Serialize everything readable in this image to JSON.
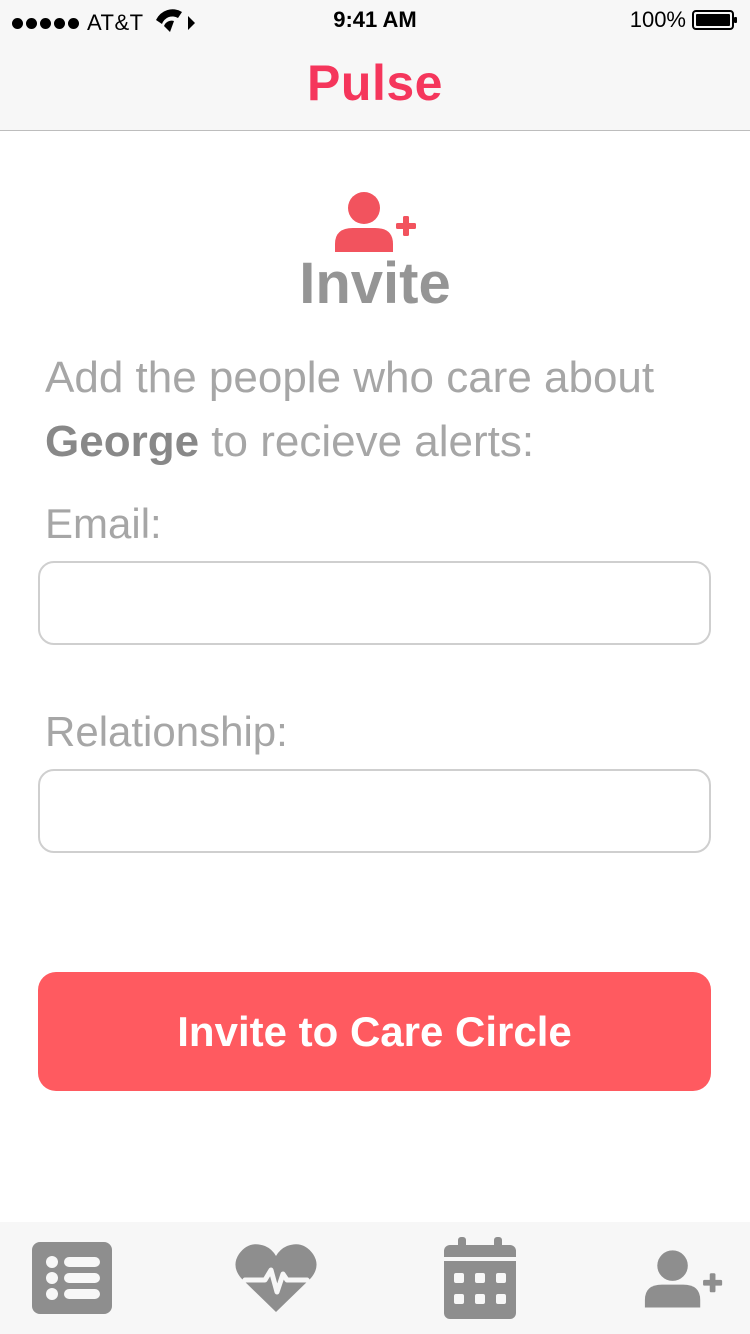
{
  "status_bar": {
    "carrier": "AT&T",
    "time": "9:41 AM",
    "battery_percent": "100%",
    "battery_level": 1.0,
    "signal_bars": 5
  },
  "app": {
    "title": "Pulse",
    "brand_color": "#f5365c",
    "accent_color": "#ff5a60"
  },
  "header": {
    "icon": "user-plus-icon",
    "heading": "Invite"
  },
  "description": {
    "before": "Add the people who care about",
    "patient_name": "George",
    "after": "to recieve alerts:"
  },
  "form": {
    "email_label": "Email:",
    "email_value": "",
    "relationship_label": "Relationship:",
    "relationship_value": ""
  },
  "cta": {
    "label": "Invite to Care Circle"
  },
  "tab_bar": {
    "tabs": [
      {
        "icon": "list-icon"
      },
      {
        "icon": "heart-pulse-icon"
      },
      {
        "icon": "calendar-icon"
      },
      {
        "icon": "user-plus-icon"
      }
    ]
  }
}
